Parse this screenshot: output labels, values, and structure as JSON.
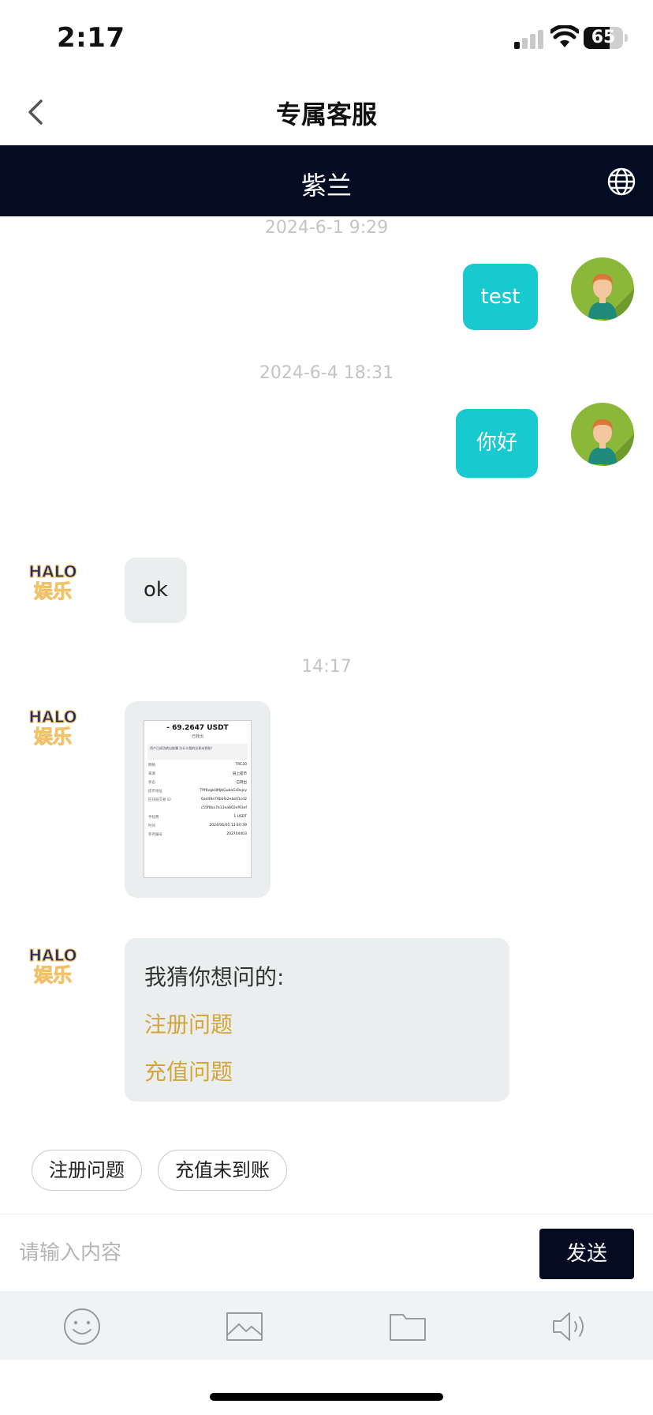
{
  "status_bar": {
    "time": "2:17",
    "battery": "65"
  },
  "nav": {
    "title": "专属客服",
    "back_icon": "chevron-left-icon"
  },
  "agent": {
    "name": "紫兰",
    "language_icon": "globe-icon"
  },
  "messages": [
    {
      "type": "timestamp",
      "text": "2024-6-1 9:29"
    },
    {
      "type": "outgoing",
      "text": "test"
    },
    {
      "type": "timestamp",
      "text": "2024-6-4 18:31"
    },
    {
      "type": "outgoing",
      "text": "你好"
    },
    {
      "type": "incoming",
      "text": "ok"
    },
    {
      "type": "timestamp",
      "text": "14:17"
    },
    {
      "type": "incoming-image"
    },
    {
      "type": "incoming-faq",
      "title": "我猜你想问的:",
      "links": [
        "注册问题",
        "充值问题"
      ]
    }
  ],
  "bot_logo": {
    "line1": "HALO",
    "line2": "娱乐"
  },
  "receipt": {
    "amount": "- 69.2647 USDT",
    "status": "已转出",
    "note": "资产已成功转出账簿 为什么我的交易未到账？",
    "rows": [
      [
        "网络",
        "TRC20"
      ],
      [
        "来源",
        "链上提币"
      ],
      [
        "状态",
        "已转出"
      ],
      [
        "提币地址",
        "TPf8xgkQMjKGuboGrDxjcy"
      ],
      [
        "区块链交易 ID",
        "6ad49e79bbfe2ebe01cd2"
      ],
      [
        "",
        "c55f6ba7b13ea802ef93ef"
      ],
      [
        "手续费",
        "1 USDT"
      ],
      [
        "时间",
        "2024/06/05 13:40:39"
      ],
      [
        "参考编号",
        "202704403"
      ]
    ]
  },
  "quick_replies": [
    "注册问题",
    "充值未到账"
  ],
  "composer": {
    "placeholder": "请输入内容",
    "send_label": "发送"
  },
  "toolbar": {
    "icons": [
      "emoji-icon",
      "image-icon",
      "folder-icon",
      "speaker-icon"
    ]
  }
}
